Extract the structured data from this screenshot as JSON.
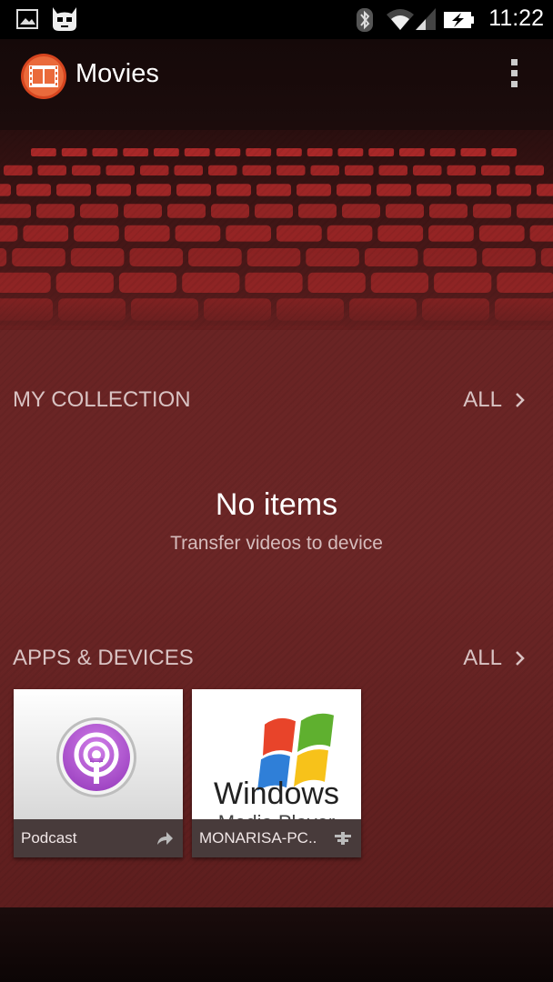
{
  "status_bar": {
    "time": "11:22",
    "icons": [
      "image-notification-icon",
      "cyanogenmod-icon",
      "bluetooth-icon",
      "wifi-icon",
      "signal-icon",
      "battery-charging-icon"
    ]
  },
  "action_bar": {
    "title": "Movies",
    "logo_icon": "movie-film-icon",
    "overflow_icon": "overflow-menu-icon"
  },
  "collection": {
    "title": "MY COLLECTION",
    "all_label": "ALL",
    "empty_title": "No items",
    "empty_subtitle": "Transfer videos to device"
  },
  "apps_devices": {
    "title": "APPS & DEVICES",
    "all_label": "ALL",
    "tiles": [
      {
        "label": "Podcast",
        "image_icon": "podcast-icon",
        "action_icon": "share-arrow-icon"
      },
      {
        "label": "MONARISA-PC..",
        "image_icon": "windows-media-player-logo",
        "image_text": "Windows Media Player",
        "action_icon": "media-server-icon"
      }
    ]
  },
  "colors": {
    "accent_logo": "#e2542e",
    "background": "#6a2424",
    "seat_red": "#b02a2a"
  }
}
